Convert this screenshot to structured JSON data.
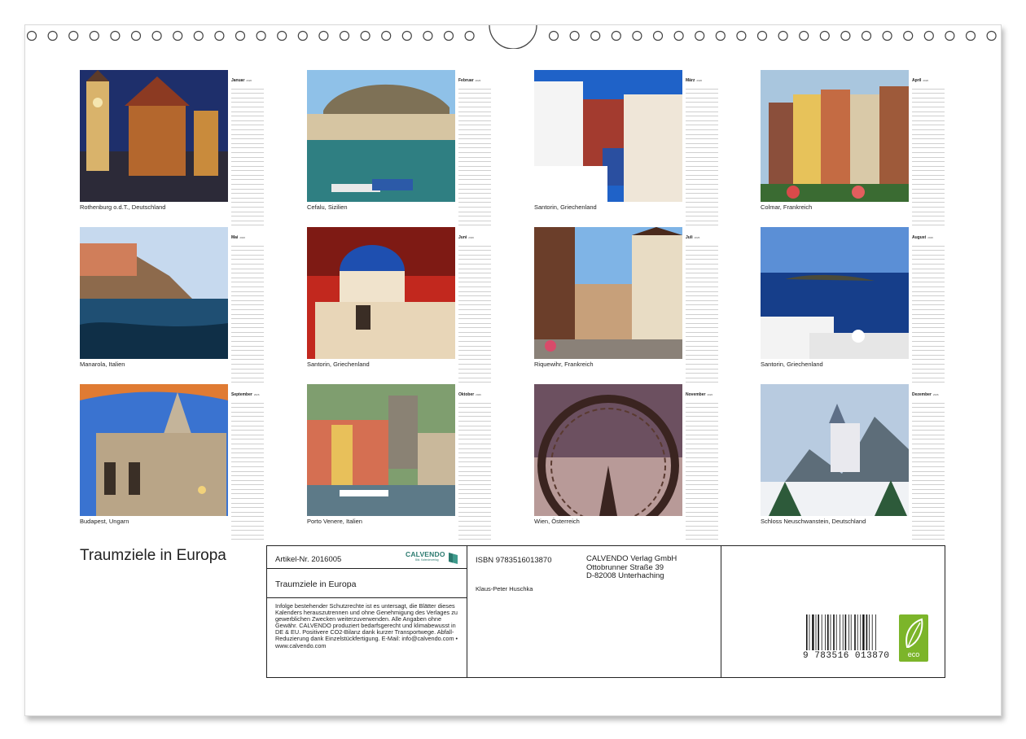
{
  "months": [
    {
      "name": "Januar",
      "year": "2026",
      "caption": "Rothenburg o.d.T., Deutschland"
    },
    {
      "name": "Februar",
      "year": "2026",
      "caption": "Cefalu, Sizilien"
    },
    {
      "name": "März",
      "year": "2026",
      "caption": "Santorin, Griechenland"
    },
    {
      "name": "April",
      "year": "2026",
      "caption": "Colmar, Frankreich"
    },
    {
      "name": "Mai",
      "year": "2026",
      "caption": "Manarola, Italien"
    },
    {
      "name": "Juni",
      "year": "2026",
      "caption": "Santorin, Griechenland"
    },
    {
      "name": "Juli",
      "year": "2026",
      "caption": "Riquewihr, Frankreich"
    },
    {
      "name": "August",
      "year": "2026",
      "caption": "Santorin, Griechenland"
    },
    {
      "name": "September",
      "year": "2026",
      "caption": "Budapest, Ungarn"
    },
    {
      "name": "Oktober",
      "year": "2026",
      "caption": "Porto Venere, Italien"
    },
    {
      "name": "November",
      "year": "2026",
      "caption": "Wien, Österreich"
    },
    {
      "name": "Dezember",
      "year": "2026",
      "caption": "Schloss Neuschwanstein, Deutschland"
    }
  ],
  "cover": {
    "title": "Traumziele in Europa"
  },
  "info": {
    "artikel": "Artikel-Nr. 2016005",
    "product_name": "Traumziele in Europa",
    "legal": "Infolge bestehender Schutzrechte ist es untersagt, die Blätter dieses Kalenders herauszutrennen und ohne Genehmigung des Verlages zu gewerblichen Zwecken weiterzuverwenden. Alle Angaben ohne Gewähr. CALVENDO produziert bedarfsgerecht und klimabewusst in DE & EU. Positivere CO2-Bilanz dank kurzer Transportwege. Abfall-Reduzierung dank Einzelstückfertigung. E-Mail: info@calvendo.com • www.calvendo.com",
    "isbn": "ISBN 9783516013870",
    "author": "Klaus-Peter Huschka",
    "publisher_line1": "CALVENDO Verlag GmbH",
    "publisher_line2": "Ottobrunner Straße 39",
    "publisher_line3": "D-82008 Unterhaching",
    "logo_name": "CALVENDO",
    "logo_tagline": "Bild. Kalenderverlag",
    "barcode_number": "9 783516 013870",
    "eco_label": "eco"
  },
  "colors": {
    "logo": "#2b7a6f",
    "eco_green": "#7cb52a",
    "border": "#222222"
  }
}
